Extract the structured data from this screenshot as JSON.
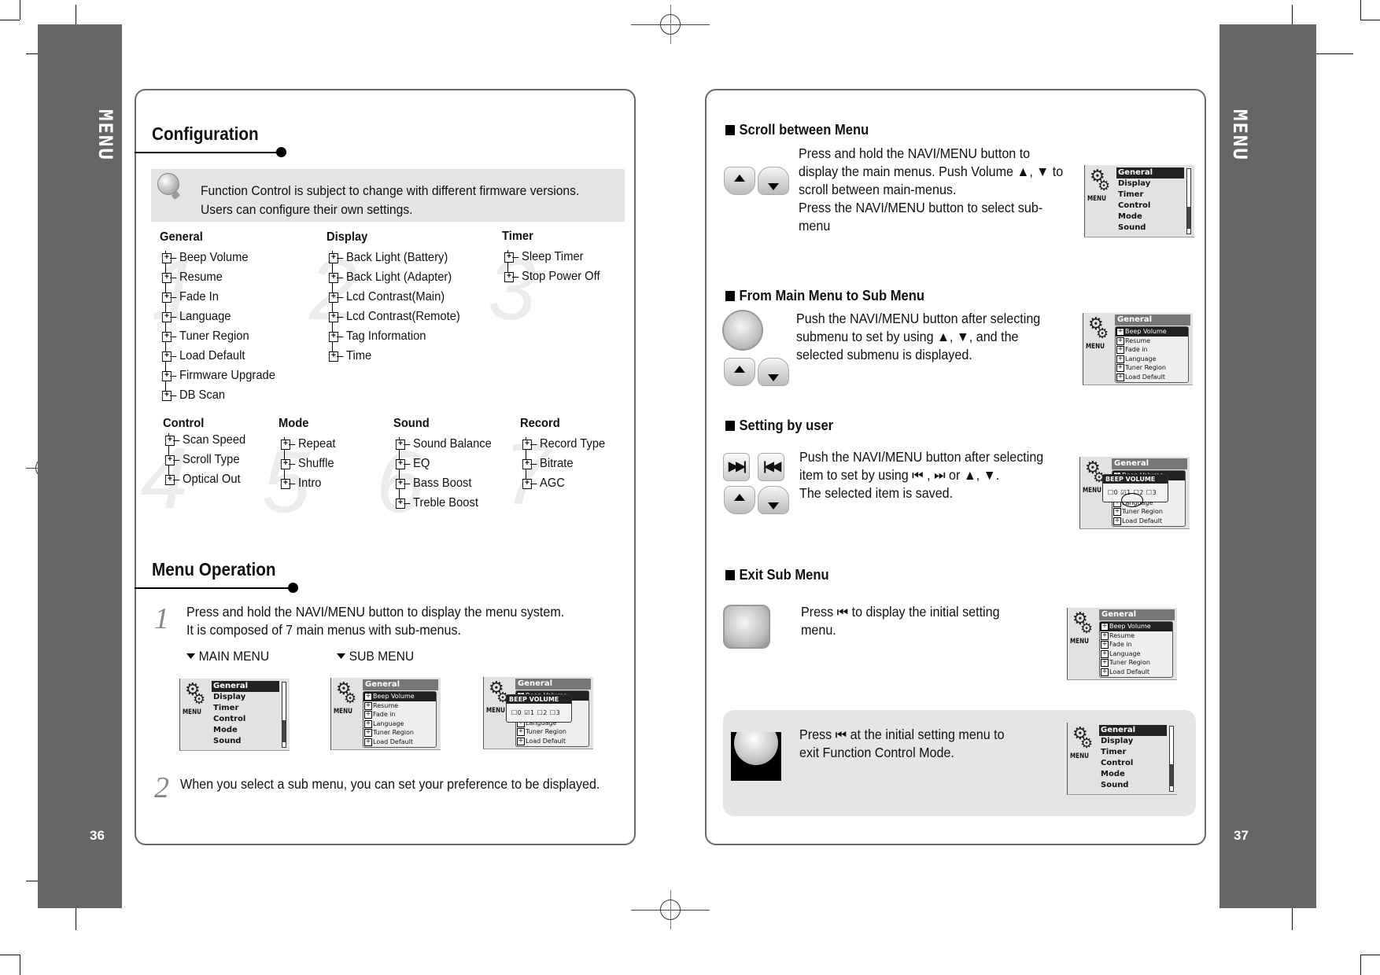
{
  "side_label": "MENU",
  "left_page": {
    "page_number": "36",
    "configuration": {
      "title": "Configuration",
      "tip_icon": "lightbulb-icon",
      "tip_lines": [
        "Function Control is subject to change with different firmware versions.",
        "Users can configure their own settings."
      ],
      "groups": [
        {
          "number": "1",
          "title": "General",
          "items": [
            "Beep Volume",
            "Resume",
            "Fade In",
            "Language",
            "Tuner Region",
            "Load Default",
            "Firmware Upgrade",
            "DB  Scan"
          ]
        },
        {
          "number": "2",
          "title": "Display",
          "items": [
            "Back Light (Battery)",
            "Back Light (Adapter)",
            "Lcd Contrast(Main)",
            "Lcd Contrast(Remote)",
            "Tag Information",
            "Time"
          ]
        },
        {
          "number": "3",
          "title": "Timer",
          "items": [
            "Sleep Timer",
            "Stop Power Off"
          ]
        },
        {
          "number": "4",
          "title": "Control",
          "items": [
            "Scan Speed",
            "Scroll Type",
            "Optical Out"
          ]
        },
        {
          "number": "5",
          "title": "Mode",
          "items": [
            "Repeat",
            "Shuffle",
            "Intro"
          ]
        },
        {
          "number": "6",
          "title": "Sound",
          "items": [
            "Sound Balance",
            "EQ",
            "Bass Boost",
            "Treble Boost"
          ]
        },
        {
          "number": "7",
          "title": "Record",
          "items": [
            "Record Type",
            "Bitrate",
            "AGC"
          ]
        }
      ]
    },
    "menu_operation": {
      "title": "Menu Operation",
      "steps": [
        {
          "number": "1",
          "lines": [
            "Press and hold the NAVI/MENU button to display the menu system.",
            "It is composed of 7 main menus with sub-menus."
          ]
        },
        {
          "number": "2",
          "lines": [
            "When you select a sub menu, you can set your preference to be displayed."
          ]
        }
      ],
      "captions": {
        "main": "MAIN MENU",
        "sub": "SUB MENU"
      }
    }
  },
  "lcd": {
    "menu_label": "MENU",
    "main_menu": [
      "General",
      "Display",
      "Timer",
      "Control",
      "Mode",
      "Sound"
    ],
    "sub_header": "General",
    "sub_menu": [
      "Beep Volume",
      "Resume",
      "Fade in",
      "Language",
      "Tuner Region",
      "Load Default"
    ],
    "popup_title": "BEEP VOLUME",
    "popup_options": "☐0  ☑1  ☐2  ☐3",
    "popup_selected": 1
  },
  "right_page": {
    "page_number": "37",
    "sections": [
      {
        "title": "Scroll between Menu",
        "lines": [
          "Press and hold the NAVI/MENU button to",
          "display the main menus.  Push Volume ▲, ▼ to",
          "scroll between main-menus.",
          "Press the NAVI/MENU button to select sub-",
          "menu"
        ]
      },
      {
        "title": "From Main Menu to Sub Menu",
        "lines": [
          "Push the NAVI/MENU button after selecting",
          "submenu to set by using ▲, ▼, and the",
          "selected submenu is displayed."
        ]
      },
      {
        "title": "Setting by user",
        "lines": [
          "Push the NAVI/MENU button after selecting",
          "item to set by using ⏮ , ⏭ or ▲, ▼.",
          "The selected item is saved."
        ]
      },
      {
        "title": "Exit Sub Menu",
        "lines": [
          "Press ⏮ to display the initial setting",
          "menu."
        ]
      }
    ],
    "exit_note": {
      "lines": [
        "Press ⏮ at the initial setting menu to",
        "exit Function Control Mode."
      ]
    }
  },
  "colors": {
    "sidebar": "#666666",
    "tip_bg": "#e4e4e4",
    "frame": "#6a6a6a"
  }
}
